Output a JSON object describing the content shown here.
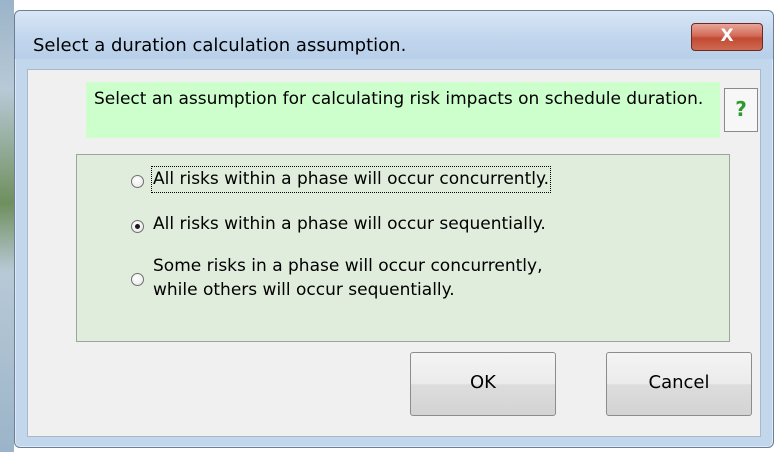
{
  "window": {
    "title": "Select a duration calculation assumption.",
    "close_label": "X"
  },
  "prompt": {
    "text": "Select an assumption for calculating risk impacts on schedule duration."
  },
  "help": {
    "label": "?"
  },
  "options": {
    "concurrent": {
      "label": "All risks within a phase will occur concurrently.",
      "selected": false
    },
    "sequential": {
      "label": "All risks within a phase will occur sequentially.",
      "selected": true
    },
    "mixed": {
      "line1": "Some risks in a phase will occur concurrently,",
      "line2": "while others will occur sequentially.",
      "selected": false
    }
  },
  "buttons": {
    "ok_label": "OK",
    "cancel_label": "Cancel"
  },
  "colors": {
    "prompt_background": "#ccffcc",
    "options_background": "#e0ecdc",
    "close_button": "#c24a33",
    "help_glyph": "#2e9a2e"
  },
  "icons": {
    "close": "close-icon",
    "help": "help-icon"
  }
}
